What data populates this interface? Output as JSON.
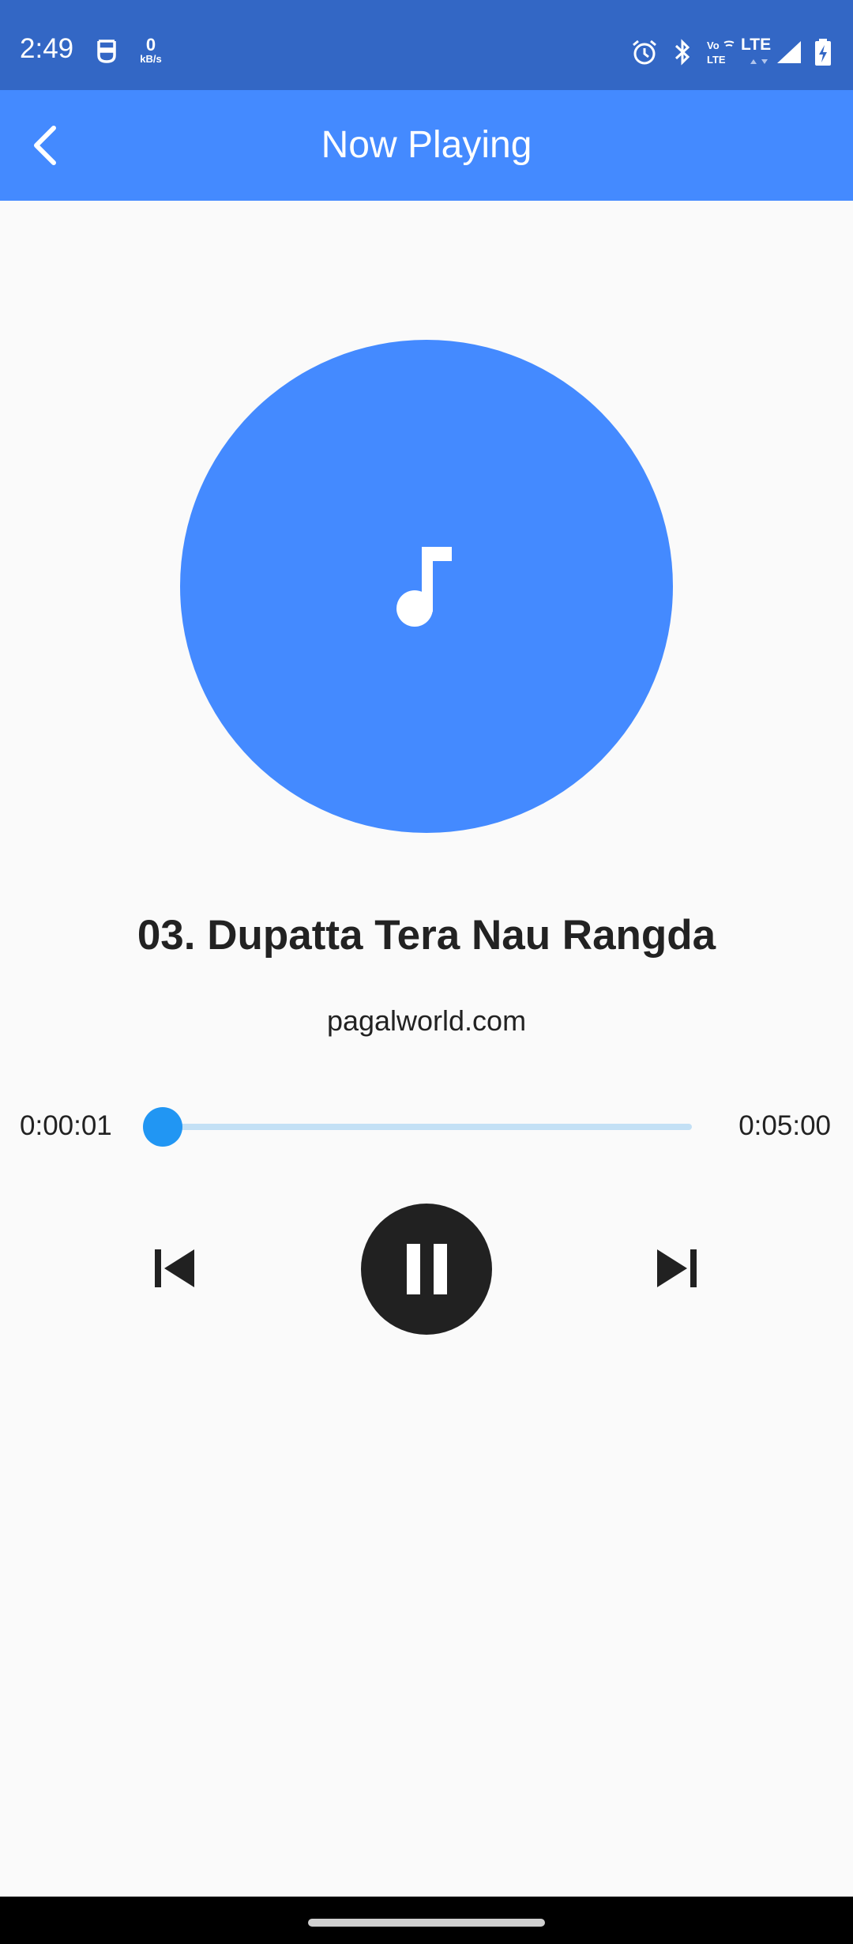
{
  "status_bar": {
    "time": "2:49",
    "data_rate_value": "0",
    "data_rate_unit": "kB/s",
    "network_label": "LTE",
    "icons": [
      "vpn-key-icon",
      "alarm-icon",
      "bluetooth-icon",
      "volte-icon",
      "lte-icon",
      "signal-icon",
      "battery-charging-icon"
    ]
  },
  "app_bar": {
    "title": "Now Playing",
    "back_icon": "chevron-left-icon",
    "color": "#448aff"
  },
  "track": {
    "title": "03. Dupatta Tera Nau Rangda",
    "source": "pagalworld.com",
    "artwork_icon": "music-note-icon",
    "artwork_color": "#448aff"
  },
  "progress": {
    "current": "0:00:01",
    "total": "0:05:00",
    "fraction": 0.003,
    "accent": "#2196f3"
  },
  "controls": {
    "previous_icon": "skip-previous-icon",
    "pause_icon": "pause-icon",
    "next_icon": "skip-next-icon"
  }
}
